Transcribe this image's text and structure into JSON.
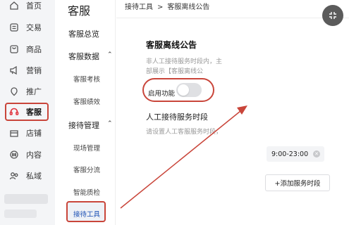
{
  "rail": {
    "items": [
      {
        "label": "首页",
        "icon": "home-icon"
      },
      {
        "label": "交易",
        "icon": "trade-icon"
      },
      {
        "label": "商品",
        "icon": "goods-icon"
      },
      {
        "label": "营销",
        "icon": "megaphone-icon"
      },
      {
        "label": "推广",
        "icon": "promote-icon"
      },
      {
        "label": "客服",
        "icon": "headset-icon"
      },
      {
        "label": "店铺",
        "icon": "store-icon"
      },
      {
        "label": "内容",
        "icon": "content-icon"
      },
      {
        "label": "私域",
        "icon": "private-domain-icon"
      }
    ],
    "active_index": 5
  },
  "sub": {
    "title": "客服",
    "overview": "客服总览",
    "data_group": "客服数据",
    "data_items": [
      "客服考核",
      "客服绩效"
    ],
    "manage_group": "接待管理",
    "manage_items": [
      "现场管理",
      "客服分流",
      "智能质检",
      "接待工具"
    ]
  },
  "breadcrumb": {
    "parent": "接待工具",
    "separator": ">",
    "current": "客服离线公告"
  },
  "panel": {
    "title": "客服离线公告",
    "desc_line1": "非人工接待服务时段内，主",
    "desc_line2": "部展示【客服离线公",
    "toggle_label": "启用功能",
    "toggle_on": false,
    "hours_title": "人工接待服务时段",
    "hours_desc": "请设置人工客服服务时段，",
    "time_range": "9:00-23:00",
    "add_button": "+添加服务时段"
  },
  "colors": {
    "highlight": "#c9453a",
    "active_icon": "#e0303a",
    "rail_bg": "#f4f5f7"
  }
}
